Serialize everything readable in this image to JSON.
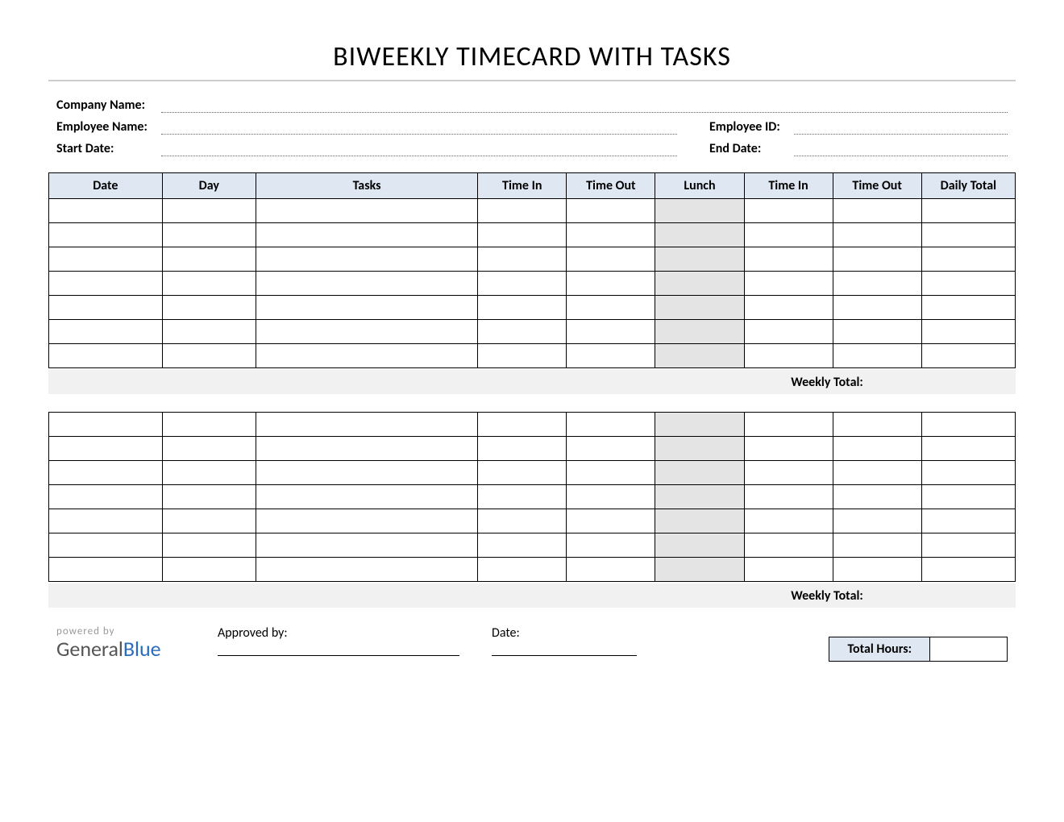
{
  "title": "BIWEEKLY TIMECARD WITH TASKS",
  "info": {
    "company_label": "Company Name:",
    "employee_label": "Employee Name:",
    "employee_id_label": "Employee ID:",
    "start_date_label": "Start Date:",
    "end_date_label": "End Date:",
    "company_value": "",
    "employee_value": "",
    "employee_id_value": "",
    "start_date_value": "",
    "end_date_value": ""
  },
  "columns": {
    "date": "Date",
    "day": "Day",
    "tasks": "Tasks",
    "time_in_1": "Time In",
    "time_out_1": "Time Out",
    "lunch": "Lunch",
    "time_in_2": "Time In",
    "time_out_2": "Time Out",
    "daily_total": "Daily Total"
  },
  "week1": {
    "rows": [
      {
        "date": "",
        "day": "",
        "tasks": "",
        "time_in_1": "",
        "time_out_1": "",
        "lunch": "",
        "time_in_2": "",
        "time_out_2": "",
        "daily_total": ""
      },
      {
        "date": "",
        "day": "",
        "tasks": "",
        "time_in_1": "",
        "time_out_1": "",
        "lunch": "",
        "time_in_2": "",
        "time_out_2": "",
        "daily_total": ""
      },
      {
        "date": "",
        "day": "",
        "tasks": "",
        "time_in_1": "",
        "time_out_1": "",
        "lunch": "",
        "time_in_2": "",
        "time_out_2": "",
        "daily_total": ""
      },
      {
        "date": "",
        "day": "",
        "tasks": "",
        "time_in_1": "",
        "time_out_1": "",
        "lunch": "",
        "time_in_2": "",
        "time_out_2": "",
        "daily_total": ""
      },
      {
        "date": "",
        "day": "",
        "tasks": "",
        "time_in_1": "",
        "time_out_1": "",
        "lunch": "",
        "time_in_2": "",
        "time_out_2": "",
        "daily_total": ""
      },
      {
        "date": "",
        "day": "",
        "tasks": "",
        "time_in_1": "",
        "time_out_1": "",
        "lunch": "",
        "time_in_2": "",
        "time_out_2": "",
        "daily_total": ""
      },
      {
        "date": "",
        "day": "",
        "tasks": "",
        "time_in_1": "",
        "time_out_1": "",
        "lunch": "",
        "time_in_2": "",
        "time_out_2": "",
        "daily_total": ""
      }
    ],
    "weekly_total_label": "Weekly Total:",
    "weekly_total_value": ""
  },
  "week2": {
    "rows": [
      {
        "date": "",
        "day": "",
        "tasks": "",
        "time_in_1": "",
        "time_out_1": "",
        "lunch": "",
        "time_in_2": "",
        "time_out_2": "",
        "daily_total": ""
      },
      {
        "date": "",
        "day": "",
        "tasks": "",
        "time_in_1": "",
        "time_out_1": "",
        "lunch": "",
        "time_in_2": "",
        "time_out_2": "",
        "daily_total": ""
      },
      {
        "date": "",
        "day": "",
        "tasks": "",
        "time_in_1": "",
        "time_out_1": "",
        "lunch": "",
        "time_in_2": "",
        "time_out_2": "",
        "daily_total": ""
      },
      {
        "date": "",
        "day": "",
        "tasks": "",
        "time_in_1": "",
        "time_out_1": "",
        "lunch": "",
        "time_in_2": "",
        "time_out_2": "",
        "daily_total": ""
      },
      {
        "date": "",
        "day": "",
        "tasks": "",
        "time_in_1": "",
        "time_out_1": "",
        "lunch": "",
        "time_in_2": "",
        "time_out_2": "",
        "daily_total": ""
      },
      {
        "date": "",
        "day": "",
        "tasks": "",
        "time_in_1": "",
        "time_out_1": "",
        "lunch": "",
        "time_in_2": "",
        "time_out_2": "",
        "daily_total": ""
      },
      {
        "date": "",
        "day": "",
        "tasks": "",
        "time_in_1": "",
        "time_out_1": "",
        "lunch": "",
        "time_in_2": "",
        "time_out_2": "",
        "daily_total": ""
      }
    ],
    "weekly_total_label": "Weekly Total:",
    "weekly_total_value": ""
  },
  "footer": {
    "powered_by_label": "powered by",
    "brand_part1": "General",
    "brand_part2": "Blue",
    "approved_by_label": "Approved by:",
    "date_label": "Date:",
    "total_hours_label": "Total Hours:",
    "total_hours_value": ""
  }
}
